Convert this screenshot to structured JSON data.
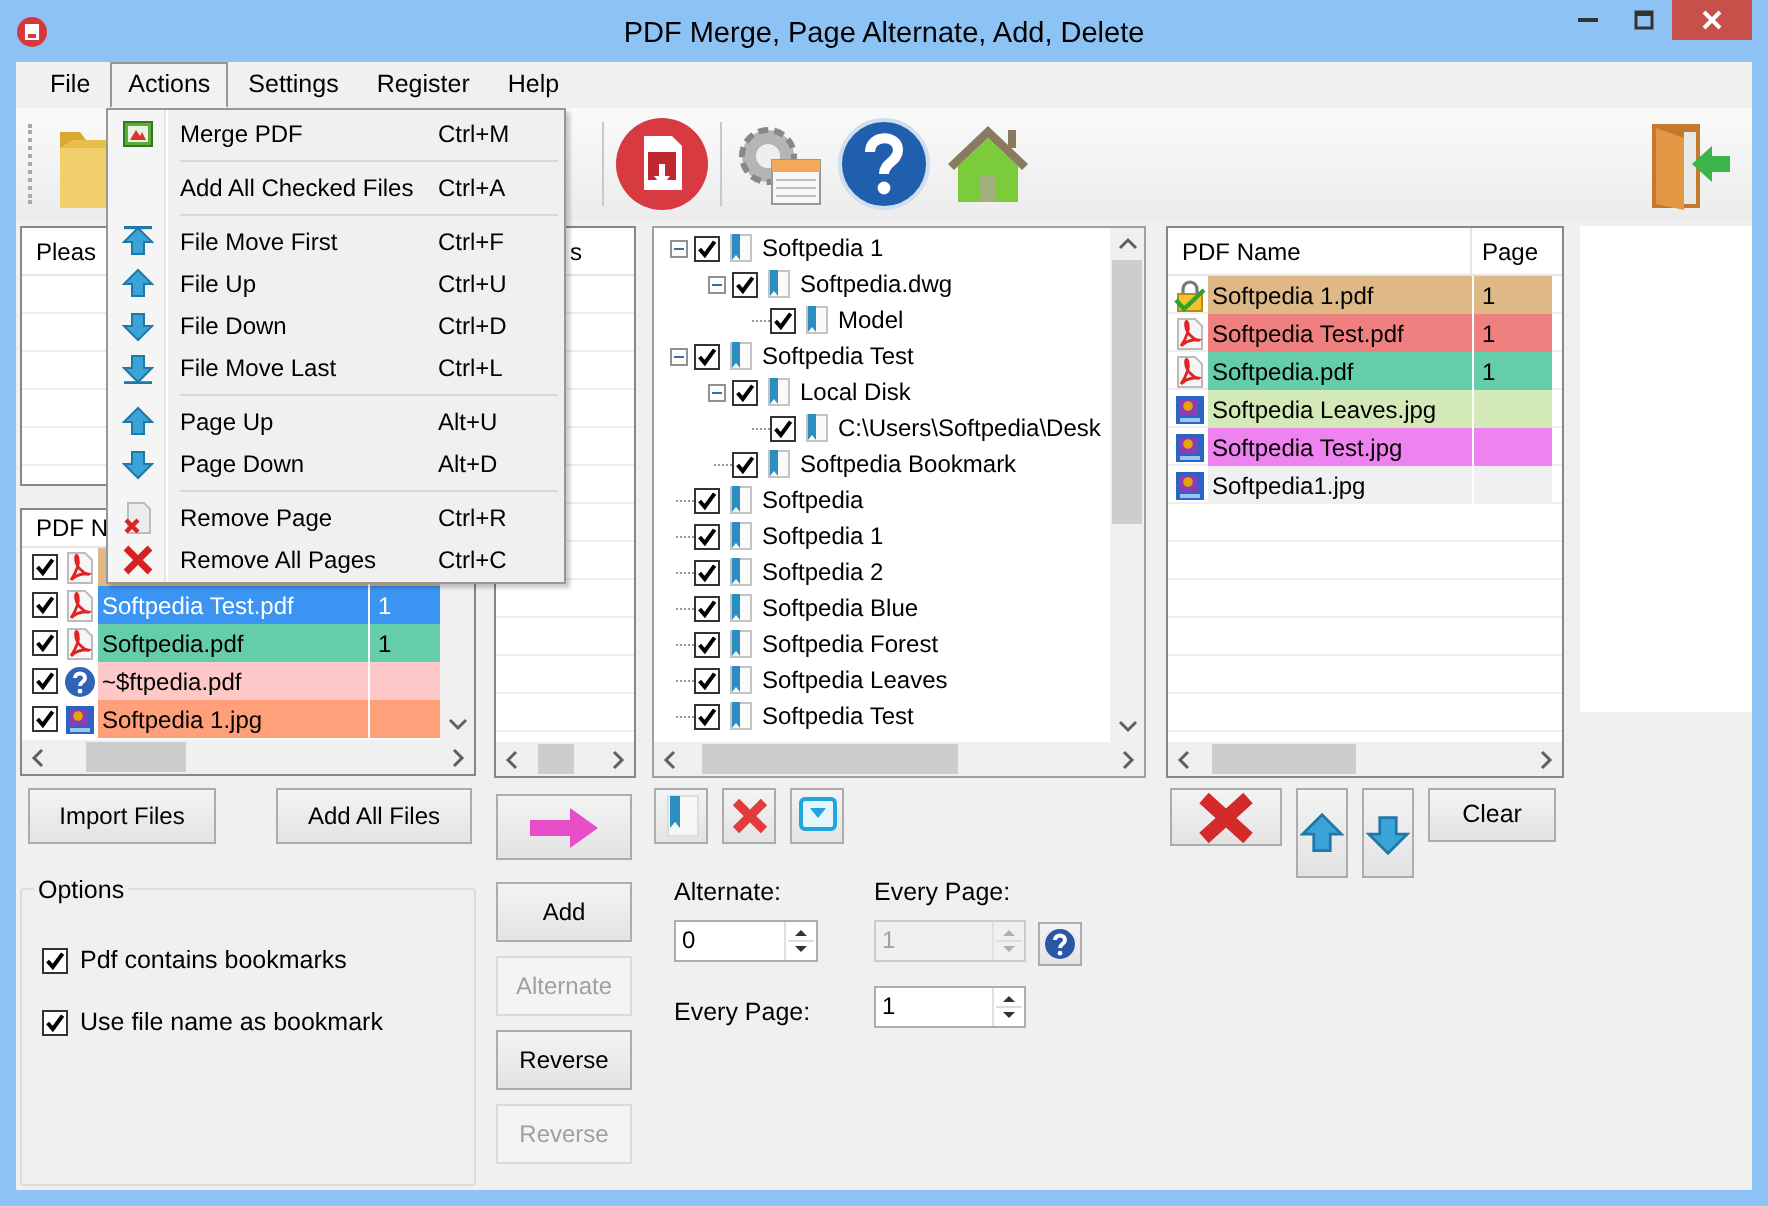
{
  "window": {
    "title": "PDF Merge, Page Alternate, Add, Delete"
  },
  "menu_bar": [
    {
      "label": "File",
      "selected": false
    },
    {
      "label": "Actions",
      "selected": true
    },
    {
      "label": "Settings",
      "selected": false
    },
    {
      "label": "Register",
      "selected": false
    },
    {
      "label": "Help",
      "selected": false
    }
  ],
  "actions_menu": [
    {
      "kind": "merge",
      "label": "Merge PDF",
      "shortcut": "Ctrl+M"
    },
    {
      "kind": "separator"
    },
    {
      "kind": "plain",
      "label": "Add All Checked Files",
      "shortcut": "Ctrl+A"
    },
    {
      "kind": "separator"
    },
    {
      "kind": "first",
      "label": "File Move First",
      "shortcut": "Ctrl+F"
    },
    {
      "kind": "up",
      "label": "File Up",
      "shortcut": "Ctrl+U"
    },
    {
      "kind": "down",
      "label": "File Down",
      "shortcut": "Ctrl+D"
    },
    {
      "kind": "last",
      "label": "File Move Last",
      "shortcut": "Ctrl+L"
    },
    {
      "kind": "separator"
    },
    {
      "kind": "up",
      "label": "Page Up",
      "shortcut": "Alt+U"
    },
    {
      "kind": "down",
      "label": "Page Down",
      "shortcut": "Alt+D"
    },
    {
      "kind": "separator"
    },
    {
      "kind": "remove_page",
      "label": "Remove Page",
      "shortcut": "Ctrl+R"
    },
    {
      "kind": "remove_all",
      "label": "Remove All Pages",
      "shortcut": "Ctrl+C"
    }
  ],
  "top_left_list": {
    "column_1": "Pleas"
  },
  "middle_list": {
    "column_1": "s"
  },
  "file_table": {
    "column_1": "PDF N",
    "rows": [
      {
        "kind": "pdf",
        "checked": true,
        "selected": false,
        "color": "#deb887"
      },
      {
        "kind": "pdf",
        "name": "Softpedia Test.pdf",
        "page": "1",
        "checked": true,
        "selected": true
      },
      {
        "kind": "pdf",
        "name": "Softpedia.pdf",
        "page": "1",
        "checked": true,
        "selected": false,
        "color": "#66cdaa"
      },
      {
        "kind": "unknown",
        "name": "~$ftpedia.pdf",
        "checked": true,
        "selected": false,
        "color": "#ffc8c8"
      },
      {
        "kind": "image",
        "name": "Softpedia 1.jpg",
        "checked": true,
        "selected": false,
        "color": "#ffa07a"
      }
    ]
  },
  "bookmark_tree": [
    {
      "label": "Softpedia 1",
      "checked": true,
      "expanded": true,
      "children": [
        {
          "label": "Softpedia.dwg",
          "checked": true,
          "expanded": true,
          "children": [
            {
              "label": "Model",
              "checked": true
            }
          ]
        }
      ]
    },
    {
      "label": "Softpedia Test",
      "checked": true,
      "expanded": true,
      "children": [
        {
          "label": "Local Disk",
          "checked": true,
          "expanded": true,
          "children": [
            {
              "label": "C:\\Users\\Softpedia\\Desk",
              "checked": true
            }
          ]
        },
        {
          "label": "Softpedia Bookmark",
          "checked": true
        }
      ]
    },
    {
      "label": "Softpedia",
      "checked": true
    },
    {
      "label": "Softpedia 1",
      "checked": true
    },
    {
      "label": "Softpedia 2",
      "checked": true
    },
    {
      "label": "Softpedia Blue",
      "checked": true
    },
    {
      "label": "Softpedia Forest",
      "checked": true
    },
    {
      "label": "Softpedia Leaves",
      "checked": true
    },
    {
      "label": "Softpedia Test",
      "checked": true
    }
  ],
  "output_table": {
    "columns": [
      "PDF Name",
      "Page"
    ],
    "rows": [
      {
        "kind": "locked",
        "name": "Softpedia 1.pdf",
        "page": "1",
        "color": "#deb887"
      },
      {
        "kind": "pdf",
        "name": "Softpedia Test.pdf",
        "page": "1",
        "color": "#f08080"
      },
      {
        "kind": "pdf",
        "name": "Softpedia.pdf",
        "page": "1",
        "color": "#66cdaa"
      },
      {
        "kind": "image",
        "name": "Softpedia Leaves.jpg",
        "color": "#d4e9b8"
      },
      {
        "kind": "image",
        "name": "Softpedia Test.jpg",
        "color": "#ee82ee"
      },
      {
        "kind": "image",
        "name": "Softpedia1.jpg",
        "color": "#f0f0f0"
      }
    ]
  },
  "import_buttons": [
    "Import Files",
    "Add All Files"
  ],
  "options": {
    "title": "Options",
    "items": [
      {
        "label": "Pdf contains bookmarks",
        "checked": true
      },
      {
        "label": "Use file name as bookmark",
        "checked": true
      }
    ]
  },
  "action_buttons": [
    {
      "kind": "arrow",
      "disabled": false
    },
    {
      "kind": "text",
      "label": "Add",
      "disabled": false
    },
    {
      "kind": "text",
      "label": "Alternate",
      "disabled": true
    },
    {
      "kind": "text",
      "label": "Reverse",
      "disabled": false
    },
    {
      "kind": "text",
      "label": "Reverse",
      "disabled": true
    }
  ],
  "alternate": {
    "label": "Alternate:",
    "value": "0",
    "disabled": false
  },
  "every_page_top": {
    "label": "Every Page:",
    "value": "1",
    "disabled": true
  },
  "every_page_bottom": {
    "label": "Every Page:",
    "value": "1",
    "disabled": false
  },
  "output_buttons": [
    {
      "kind": "delete"
    },
    {
      "kind": "up"
    },
    {
      "kind": "down"
    },
    {
      "kind": "text",
      "label": "Clear"
    }
  ]
}
